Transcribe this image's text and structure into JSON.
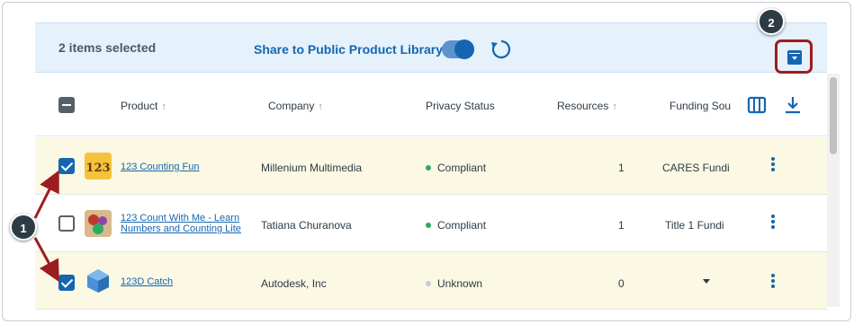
{
  "selection_bar": {
    "count_text": "2 items selected",
    "share_label": "Share to Public Product Library",
    "share_toggle_on": true
  },
  "header": {
    "columns": [
      "Product",
      "Company",
      "Privacy Status",
      "Resources",
      "Funding Sou"
    ],
    "select_all_state": "indeterminate"
  },
  "rows": [
    {
      "checked": true,
      "product": "123 Counting Fun",
      "company": "Millenium Multimedia",
      "privacy": "Compliant",
      "resources": "1",
      "funding": "CARES Fundi"
    },
    {
      "checked": false,
      "product_line1": "123 Count With Me - Learn",
      "product_line2": "Numbers and Counting Lite",
      "company": "Tatiana Churanova",
      "privacy": "Compliant",
      "resources": "1",
      "funding": "Title 1 Fundi"
    },
    {
      "checked": true,
      "product": "123D Catch",
      "company": "Autodesk, Inc",
      "privacy": "Unknown",
      "resources": "0",
      "funding": ""
    }
  ],
  "callouts": {
    "one": "1",
    "two": "2"
  },
  "colors": {
    "accent": "#1466b1",
    "selection_bar_bg": "#e5f1fb",
    "selected_row_bg": "#fbf8e3",
    "compliant_dot": "#2ea866",
    "unknown_dot": "#c7cdd1",
    "callout_highlight": "#9b1d20"
  },
  "icons": [
    "refresh-icon",
    "archive-icon",
    "columns-icon",
    "download-icon",
    "more-options-icon",
    "sort-up-icon"
  ]
}
